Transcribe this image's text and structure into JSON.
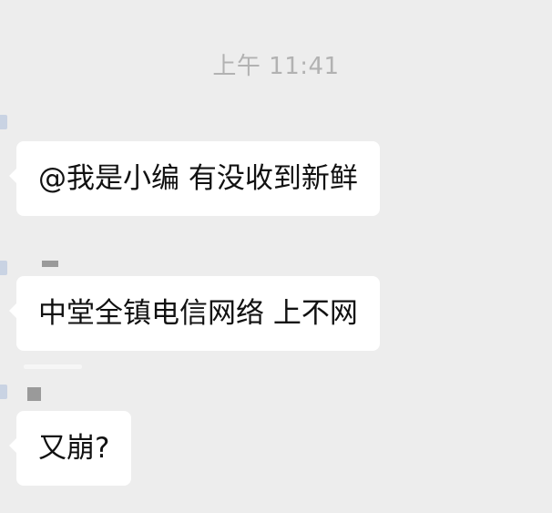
{
  "chat": {
    "timestamp": "上午 11:41",
    "messages": [
      {
        "text": "@我是小编 有没收到新鲜"
      },
      {
        "text": "中堂全镇电信网络 上不网"
      },
      {
        "text": "又崩?"
      }
    ]
  },
  "colors": {
    "background": "#ededed",
    "bubble": "#ffffff",
    "timestamp_text": "#b2b2b2",
    "message_text": "#111111"
  }
}
